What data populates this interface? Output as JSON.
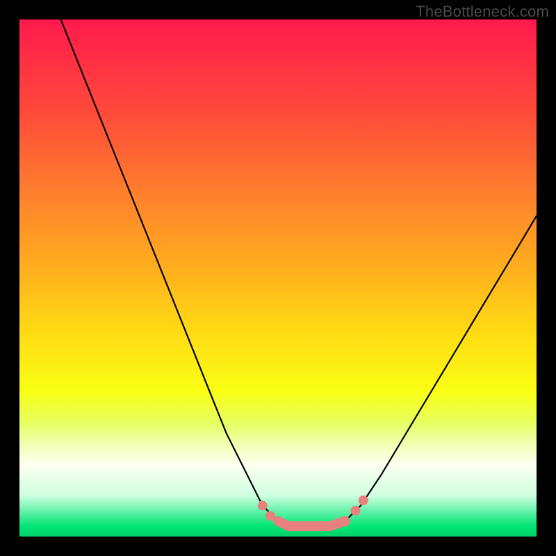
{
  "watermark": "TheBottleneck.com",
  "chart_data": {
    "type": "line",
    "title": "",
    "xlabel": "",
    "ylabel": "",
    "xlim": [
      0,
      100
    ],
    "ylim": [
      0,
      100
    ],
    "series": [
      {
        "name": "curve",
        "points": [
          {
            "x": 8,
            "y": 100
          },
          {
            "x": 12,
            "y": 90
          },
          {
            "x": 18,
            "y": 75
          },
          {
            "x": 24,
            "y": 60
          },
          {
            "x": 30,
            "y": 45
          },
          {
            "x": 36,
            "y": 30
          },
          {
            "x": 40,
            "y": 20
          },
          {
            "x": 44,
            "y": 12
          },
          {
            "x": 47,
            "y": 6
          },
          {
            "x": 50,
            "y": 3
          },
          {
            "x": 52,
            "y": 2
          },
          {
            "x": 56,
            "y": 2
          },
          {
            "x": 60,
            "y": 2
          },
          {
            "x": 63,
            "y": 3
          },
          {
            "x": 66,
            "y": 6
          },
          {
            "x": 70,
            "y": 12
          },
          {
            "x": 76,
            "y": 22
          },
          {
            "x": 82,
            "y": 32
          },
          {
            "x": 88,
            "y": 42
          },
          {
            "x": 94,
            "y": 52
          },
          {
            "x": 100,
            "y": 62
          }
        ]
      }
    ],
    "markers": [
      {
        "x": 47,
        "y": 6
      },
      {
        "x": 48.5,
        "y": 4
      },
      {
        "x": 50,
        "y": 3
      },
      {
        "x": 52,
        "y": 2
      },
      {
        "x": 56,
        "y": 2
      },
      {
        "x": 60,
        "y": 2
      },
      {
        "x": 63,
        "y": 3
      },
      {
        "x": 65,
        "y": 5
      },
      {
        "x": 66.5,
        "y": 7
      }
    ],
    "marker_color": "#e88080",
    "curve_color": "#000000"
  }
}
